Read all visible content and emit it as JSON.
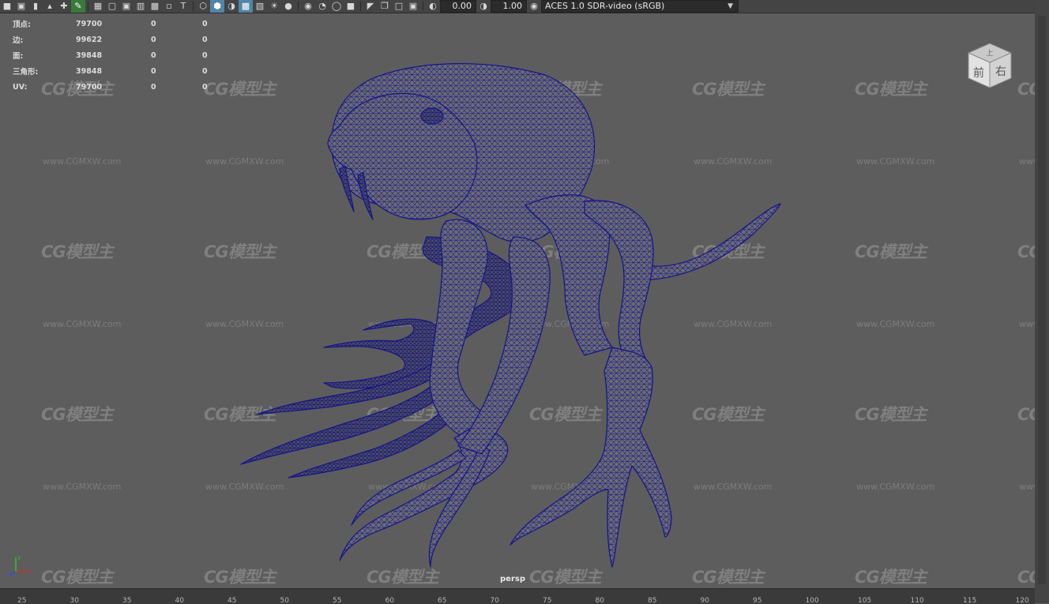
{
  "toolbar": {
    "icons_group1": [
      "camera-icon",
      "camera-attributes-icon",
      "bookmark-icon",
      "image-plane-icon",
      "move-icon",
      "pencil-icon"
    ],
    "icons_group2": [
      "grid-icon",
      "film-gate-icon",
      "resolution-gate-icon",
      "gate-mask-icon",
      "field-chart-icon",
      "safe-action-icon",
      "safe-title-icon"
    ],
    "icons_group3": [
      "wireframe-icon",
      "smooth-shade-icon",
      "default-material-icon",
      "wireframe-on-shaded-icon",
      "textured-icon",
      "use-lights-icon",
      "shadows-icon"
    ],
    "icons_group4": [
      "screen-space-ao-icon",
      "motion-blur-icon",
      "anti-aliasing-icon",
      "depth-of-field-icon"
    ],
    "icons_group5": [
      "isolate-select-icon",
      "xray-icon",
      "xray-active-icon",
      "xray-joints-icon"
    ],
    "exposure_value": "0.00",
    "gamma_value": "1.00",
    "color_space": "ACES 1.0 SDR-video (sRGB)"
  },
  "hud": {
    "rows": [
      {
        "label": "顶点:",
        "v1": "79700",
        "v2": "0",
        "v3": "0"
      },
      {
        "label": "边:",
        "v1": "99622",
        "v2": "0",
        "v3": "0"
      },
      {
        "label": "面:",
        "v1": "39848",
        "v2": "0",
        "v3": "0"
      },
      {
        "label": "三角形:",
        "v1": "39848",
        "v2": "0",
        "v3": "0"
      },
      {
        "label": "UV:",
        "v1": "79700",
        "v2": "0",
        "v3": "0"
      }
    ]
  },
  "viewcube": {
    "front": "前",
    "right": "右",
    "top": "上"
  },
  "camera_label": "persp",
  "watermark": {
    "logo": "CG模型主",
    "url": "www.CGMXW.com"
  },
  "axis": {
    "x": "x",
    "y": "y",
    "z": "z"
  },
  "timeline": {
    "ticks": [
      "25",
      "30",
      "35",
      "40",
      "45",
      "50",
      "55",
      "60",
      "65",
      "70",
      "75",
      "80",
      "85",
      "90",
      "95",
      "100",
      "105",
      "110",
      "115",
      "120"
    ]
  }
}
